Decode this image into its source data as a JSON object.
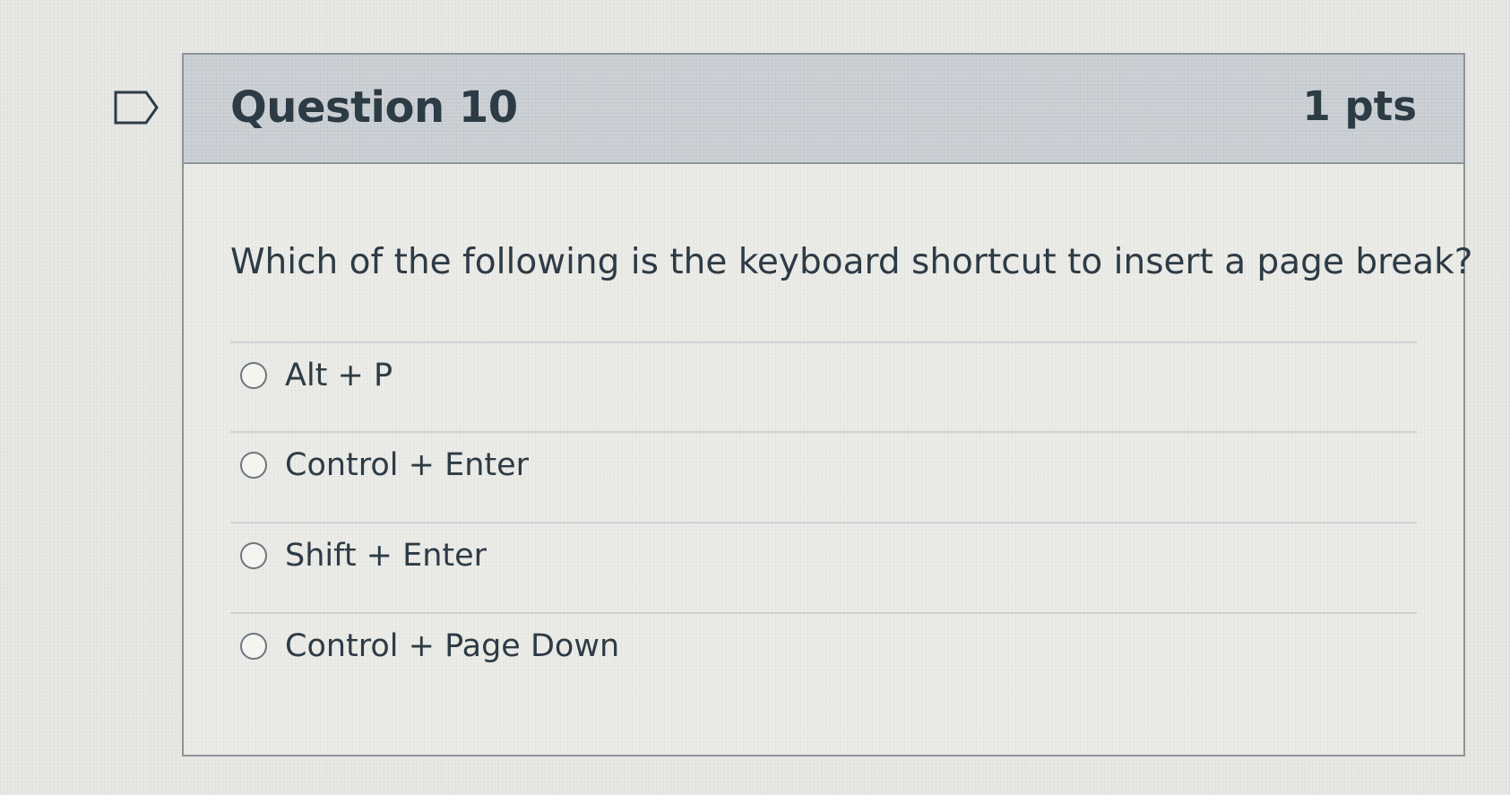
{
  "question": {
    "title": "Question 10",
    "points": "1 pts",
    "text": "Which of the following is the keyboard shortcut to insert a page break?",
    "flag_icon": "flag-outline-icon"
  },
  "answers": [
    {
      "label": "Alt + P",
      "selected": false
    },
    {
      "label": "Control + Enter",
      "selected": false
    },
    {
      "label": "Shift + Enter",
      "selected": false
    },
    {
      "label": "Control + Page Down",
      "selected": false
    }
  ],
  "colors": {
    "header_bg": "#c9ced3",
    "text": "#2d3b45",
    "border": "#8e9499"
  }
}
